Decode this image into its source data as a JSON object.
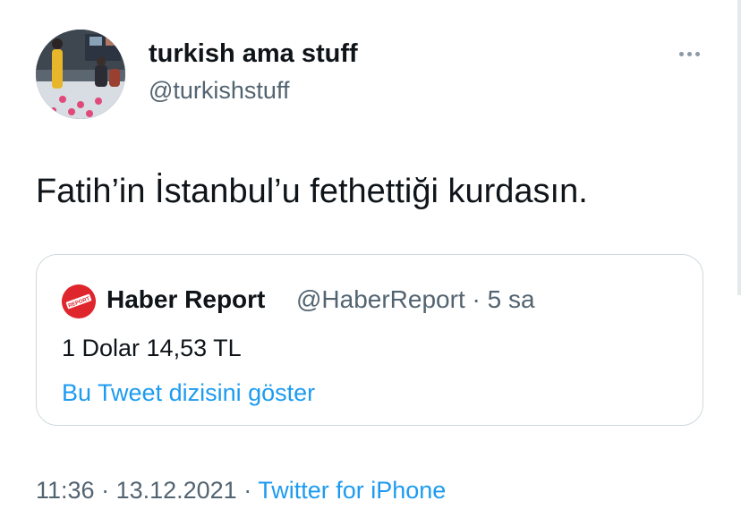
{
  "tweet": {
    "author_name": "turkish ama stuff",
    "author_handle": "@turkishstuff",
    "text": "Fatih’in İstanbul’u fethettiği kurdasın.",
    "more_icon": "more-horizontal-icon"
  },
  "quoted_tweet": {
    "avatar_label": "REPORT",
    "author_name": "Haber Report",
    "meta": "@HaberReport · 5 sa",
    "text": "1 Dolar 14,53 TL",
    "show_thread_label": "Bu Tweet dizisini göster"
  },
  "footer": {
    "time": "11:36",
    "separator1": " · ",
    "date": "13.12.2021",
    "separator2": " · ",
    "source": "Twitter for iPhone"
  },
  "colors": {
    "text": "#0f1419",
    "secondary": "#536471",
    "link": "#1d9bf0",
    "border": "#cfd9de",
    "quote_avatar": "#e0262d"
  }
}
